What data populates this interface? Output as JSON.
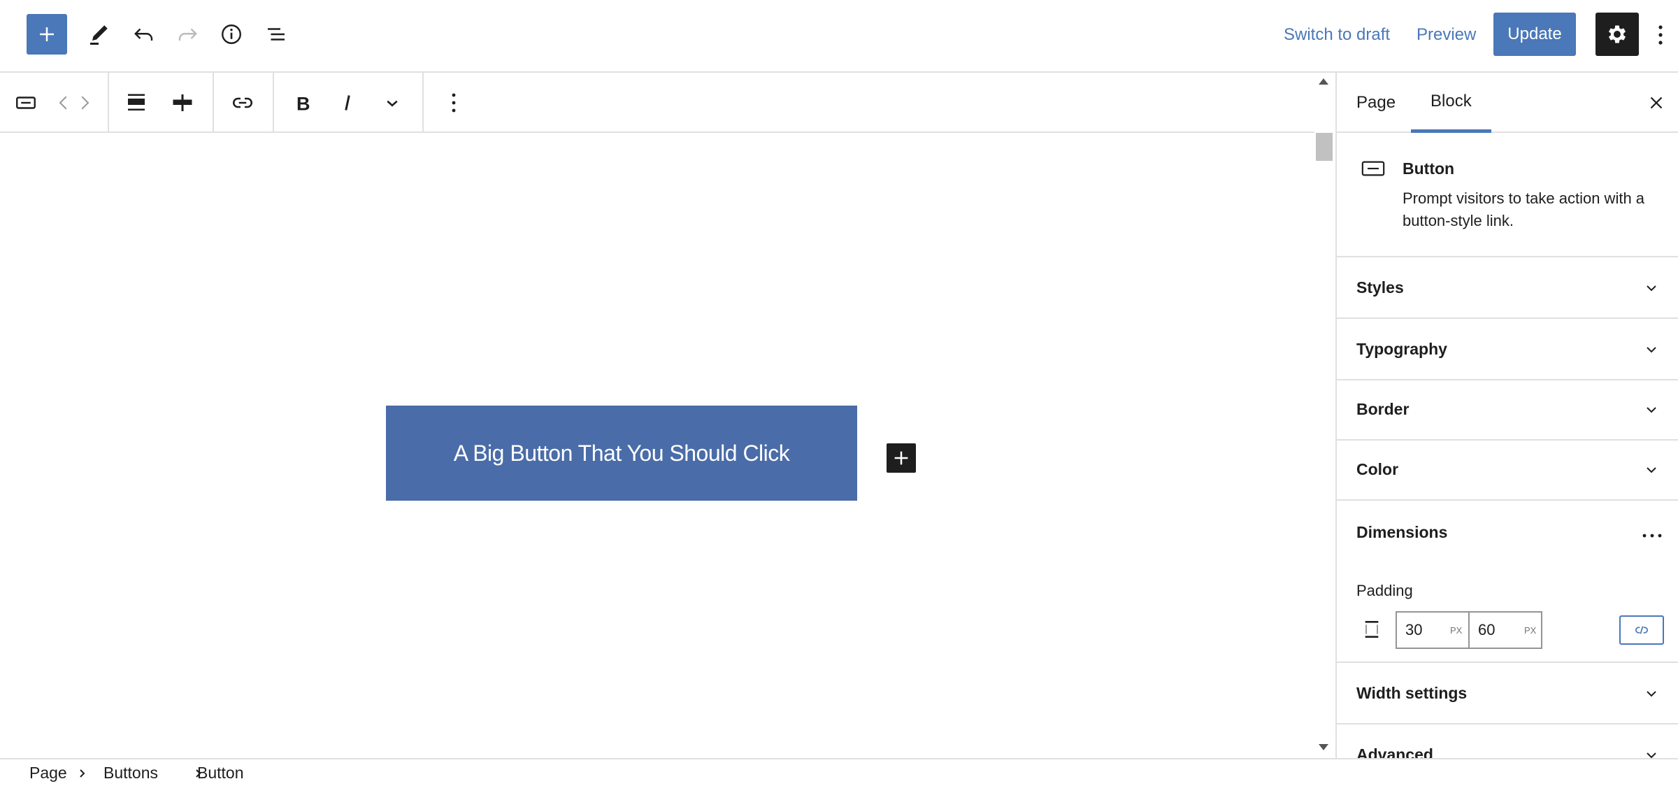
{
  "header": {
    "switch_to_draft": "Switch to draft",
    "preview": "Preview",
    "update": "Update",
    "icons": [
      "plus-icon",
      "pencil-icon",
      "undo-icon",
      "redo-icon",
      "info-icon",
      "list-view-icon",
      "gear-icon",
      "more-vertical-icon"
    ]
  },
  "block_toolbar": {
    "icons": [
      "button-block-icon",
      "chevron-left-icon",
      "chevron-right-icon",
      "justify-stretch-icon",
      "justify-center-icon",
      "link-icon",
      "bold-icon",
      "italic-icon",
      "chevron-down-icon",
      "more-vertical-icon"
    ]
  },
  "canvas": {
    "button_text": "A Big Button That You Should Click",
    "button_color": "#4a6ca8"
  },
  "sidebar": {
    "tabs": [
      {
        "label": "Page",
        "active": false
      },
      {
        "label": "Block",
        "active": true
      }
    ],
    "block": {
      "title": "Button",
      "description": "Prompt visitors to take action with a button-style link."
    },
    "panels": {
      "styles": "Styles",
      "typography": "Typography",
      "border": "Border",
      "color": "Color",
      "dimensions": "Dimensions",
      "width_settings": "Width settings",
      "advanced": "Advanced"
    },
    "padding": {
      "label": "Padding",
      "vertical_value": "30",
      "horizontal_value": "60",
      "unit": "PX"
    }
  },
  "breadcrumb": [
    "Page",
    "Buttons",
    "Button"
  ],
  "colors": {
    "accent": "#4a78b8",
    "dark": "#1e1e1e",
    "border": "#e0e0e0"
  }
}
